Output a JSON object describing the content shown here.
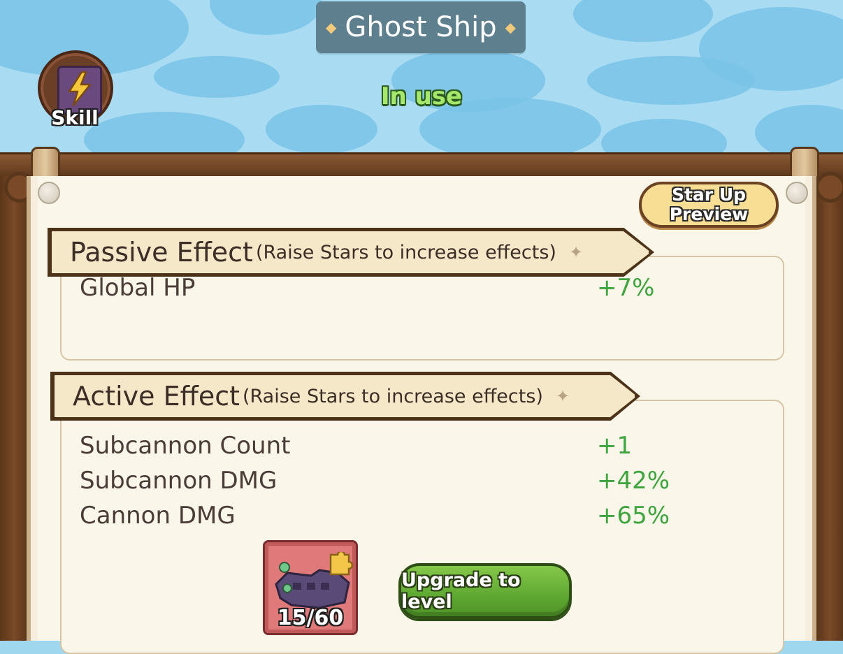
{
  "header": {
    "title": "Ghost Ship",
    "status": "In use"
  },
  "skill_button": {
    "label": "Skill"
  },
  "star_up_button": {
    "line1": "Star Up",
    "line2": "Preview"
  },
  "passive_effect": {
    "title": "Passive Effect",
    "subtitle": "(Raise Stars to increase effects)",
    "stats": [
      {
        "name": "Global HP",
        "value": "+7%"
      }
    ]
  },
  "active_effect": {
    "title": "Active Effect",
    "subtitle": "(Raise Stars to increase effects)",
    "stats": [
      {
        "name": "Subcannon Count",
        "value": "+1"
      },
      {
        "name": "Subcannon DMG",
        "value": "+42%"
      },
      {
        "name": "Cannon DMG",
        "value": "+65%"
      }
    ]
  },
  "material": {
    "count": "15/60",
    "icon": "ship-fragment-icon",
    "progress": 0.25
  },
  "upgrade_button": {
    "label": "Upgrade to level"
  },
  "colors": {
    "status_green": "#a6e86c",
    "value_green": "#3ea43e",
    "title_plate": "#5e7f8e",
    "wood": "#6e4424",
    "parchment": "#fbf6ea"
  }
}
